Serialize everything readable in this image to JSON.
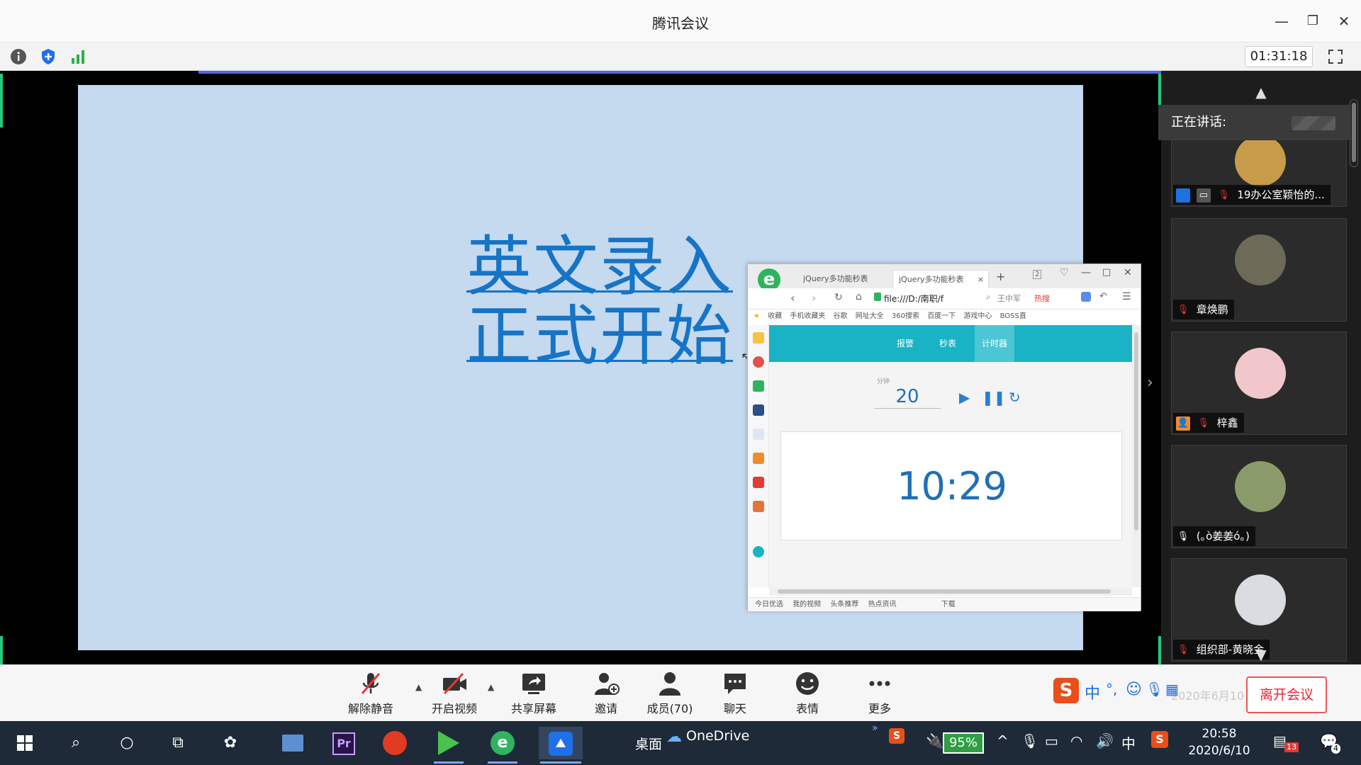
{
  "window": {
    "title": "腾讯会议",
    "minimize": "—",
    "restore": "❐",
    "close": "✕"
  },
  "meeting_bar": {
    "duration": "01:31:18",
    "info_icon": "info-icon",
    "security_icon": "shield-icon",
    "signal_icon": "signal-icon",
    "fullscreen_icon": "fullscreen-icon"
  },
  "slide": {
    "line1": "英文录入",
    "line2": "正式开始"
  },
  "browser": {
    "tabs": [
      "jQuery多功能秒表",
      "jQuery多功能秒表"
    ],
    "tab_close": "×",
    "tab_add": "+",
    "tab_count": "2",
    "url": "file:///D:/南职/f",
    "search_placeholder": "王中军",
    "hot_search": "热搜",
    "favorites": [
      "收藏",
      "手机收藏夹",
      "谷歌",
      "网址大全",
      "360搜索",
      "百度一下",
      "游戏中心",
      "BOSS直"
    ],
    "nav": [
      "报警",
      "秒表",
      "计时器"
    ],
    "active_nav": "计时器",
    "minutes_label": "分钟",
    "minutes_value": "20",
    "countdown": "10:29",
    "status_items": [
      "今日优选",
      "我的视频",
      "头条推荐",
      "热点资讯",
      "下载"
    ]
  },
  "participants": {
    "speaking_label": "正在讲话:",
    "list": [
      {
        "name": "19办公室颖怡的...",
        "avatar_color": "#c89b4a"
      },
      {
        "name": "章焕鹏",
        "avatar_color": "#6d6a58"
      },
      {
        "name": "梓鑫",
        "avatar_color": "#f1c7cc"
      },
      {
        "name": "(｡ò姜姜ó｡)",
        "avatar_color": "#8a9a6a"
      },
      {
        "name": "组织部-黄晓金",
        "avatar_color": "#d9dce0"
      }
    ]
  },
  "controls": {
    "unmute": "解除静音",
    "start_video": "开启视频",
    "share_screen": "共享屏幕",
    "invite": "邀请",
    "members": "成员(70)",
    "chat": "聊天",
    "emoji": "表情",
    "more": "更多",
    "leave": "离开会议",
    "faded_date": "2020年6月10日"
  },
  "taskbar": {
    "desktop": "桌面",
    "onedrive": "OneDrive",
    "battery": "95%",
    "time": "20:58",
    "date": "2020/6/10",
    "input_lang": "中",
    "badge_count": "13",
    "notification_count": "4"
  },
  "colors": {
    "accent": "#1ab3c6",
    "slide_bg": "#c5d9ef",
    "slide_text": "#1674c6",
    "leave": "#e23333"
  }
}
